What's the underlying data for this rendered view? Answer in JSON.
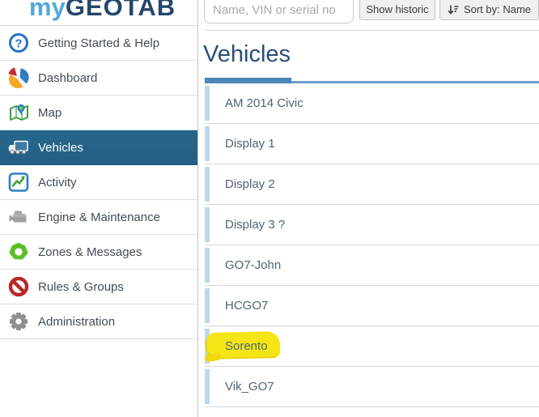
{
  "logo": {
    "prefix": "my",
    "suffix": "GEOTAB"
  },
  "sidebar": {
    "items": [
      {
        "label": "Getting Started & Help",
        "icon": "help-icon",
        "selected": false
      },
      {
        "label": "Dashboard",
        "icon": "pie-chart-icon",
        "selected": false
      },
      {
        "label": "Map",
        "icon": "map-icon",
        "selected": false
      },
      {
        "label": "Vehicles",
        "icon": "truck-icon",
        "selected": true
      },
      {
        "label": "Activity",
        "icon": "activity-chart-icon",
        "selected": false
      },
      {
        "label": "Engine & Maintenance",
        "icon": "engine-icon",
        "selected": false
      },
      {
        "label": "Zones & Messages",
        "icon": "zone-icon",
        "selected": false
      },
      {
        "label": "Rules & Groups",
        "icon": "prohibition-icon",
        "selected": false
      },
      {
        "label": "Administration",
        "icon": "gear-icon",
        "selected": false
      }
    ]
  },
  "topbar": {
    "search_placeholder": "Name, VIN or serial no",
    "show_historic_label": "Show historic",
    "sort_label": "Sort by: Name"
  },
  "main": {
    "title": "Vehicles"
  },
  "vehicles": {
    "rows": [
      "AM 2014 Civic",
      "Display 1",
      "Display 2",
      "Display 3 ?",
      "GO7-John",
      "HCGO7",
      "Sorento",
      "Vik_GO7"
    ],
    "highlighted": "Sorento"
  },
  "colors": {
    "selected_nav_bg": "#256389",
    "tab_accent": "#4c86b8",
    "highlight_yellow": "#f5e516",
    "logo_light_blue": "#55a7d9",
    "logo_dark_blue": "#24476a",
    "row_bar_blue": "#bcd8eb"
  }
}
